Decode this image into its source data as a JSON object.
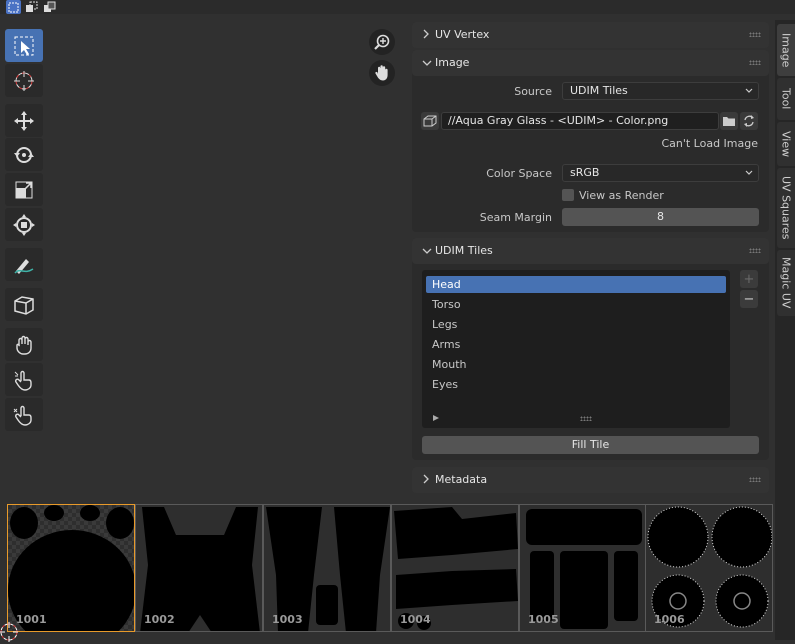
{
  "sidebar": {
    "uv_vertex_panel": {
      "title": "UV Vertex"
    },
    "image_panel": {
      "title": "Image",
      "source_label": "Source",
      "source_value": "UDIM Tiles",
      "filepath": "//Aqua Gray Glass - <UDIM> - Color.png",
      "status": "Can't Load Image",
      "color_space_label": "Color Space",
      "color_space_value": "sRGB",
      "view_as_render_label": "View as Render",
      "view_as_render_checked": false,
      "seam_margin_label": "Seam Margin",
      "seam_margin_value": "8"
    },
    "udim_panel": {
      "title": "UDIM Tiles",
      "tiles": [
        "Head",
        "Torso",
        "Legs",
        "Arms",
        "Mouth",
        "Eyes"
      ],
      "selected_index": 0,
      "add_symbol": "+",
      "remove_symbol": "−",
      "fill_button": "Fill Tile"
    },
    "metadata_panel": {
      "title": "Metadata"
    }
  },
  "tabs": [
    "Image",
    "Tool",
    "View",
    "UV Squares",
    "Magic UV"
  ],
  "active_tab": "Image",
  "udim_grid": {
    "tiles": [
      "1001",
      "1002",
      "1003",
      "1004",
      "1005",
      "1006"
    ],
    "active_tile": "1001"
  },
  "toolbar": {
    "tools": [
      "select-box",
      "cursor",
      "move",
      "rotate",
      "scale",
      "transform",
      "annotate",
      "rip-region",
      "grab",
      "relax",
      "pinch"
    ],
    "active_tool": "select-box"
  },
  "colors": {
    "accent": "#4772b3",
    "active_tile_border": "#e89a2a",
    "background": "#303030"
  }
}
